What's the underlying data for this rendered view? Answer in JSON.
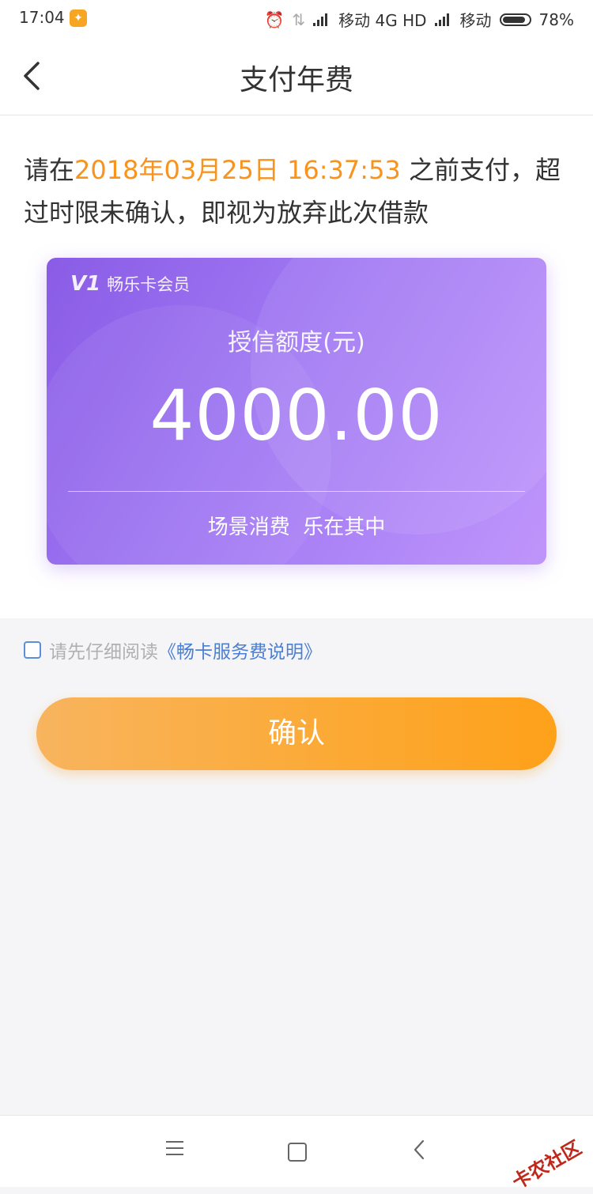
{
  "status_bar": {
    "time": "17:04",
    "carrier1": "移动 4G HD",
    "carrier2": "移动",
    "battery": "78%"
  },
  "nav": {
    "title": "支付年费"
  },
  "notice": {
    "prefix": "请在",
    "deadline": "2018年03月25日 16:37:53",
    "suffix": " 之前支付，超过时限未确认，即视为放弃此次借款"
  },
  "card": {
    "brand_logo": "V1",
    "brand_name": "畅乐卡会员",
    "label": "授信额度(元)",
    "amount": "4000.00",
    "slogan": "场景消费  乐在其中"
  },
  "agreement": {
    "text": "请先仔细阅读",
    "link": "《畅卡服务费说明》",
    "checked": false
  },
  "confirm_button": "确认",
  "watermark": "卡农社区",
  "colors": {
    "accent_orange": "#f7931e",
    "card_purple": "#a078f3",
    "link_blue": "#4a7fd4"
  }
}
